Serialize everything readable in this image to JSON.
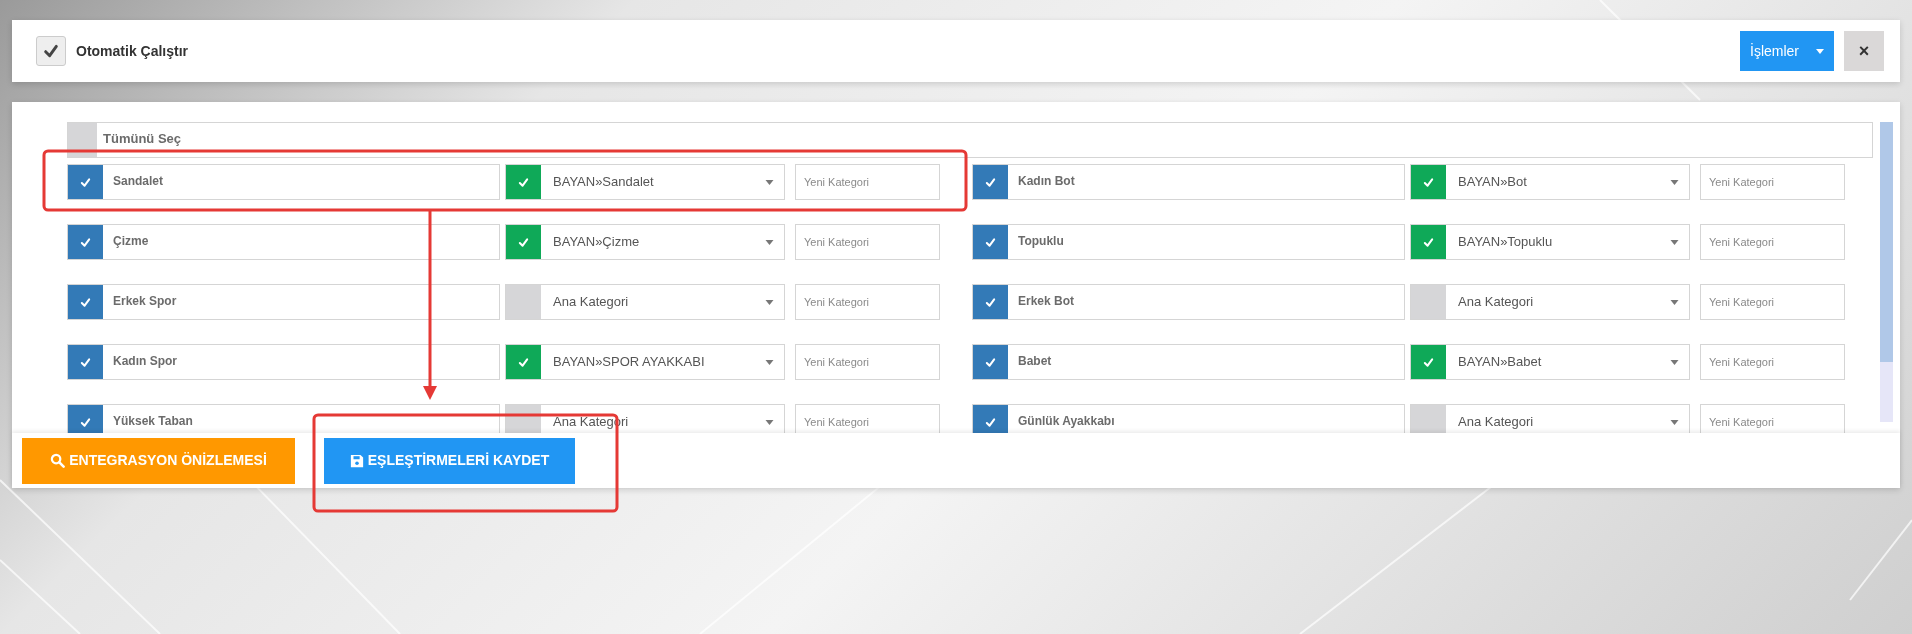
{
  "header": {
    "auto_run": {
      "label": "Otomatik Çalıştır",
      "checked": true
    },
    "actions_button": "İşlemler",
    "close_button": "×"
  },
  "select_all": {
    "label": "Tümünü Seç",
    "checked": false
  },
  "mappings": [
    {
      "checked": true,
      "name": "Sandalet",
      "category": "BAYAN»Sandalet",
      "matched": true,
      "new_category_placeholder": "Yeni Kategori"
    },
    {
      "checked": true,
      "name": "Kadın Bot",
      "category": "BAYAN»Bot",
      "matched": true,
      "new_category_placeholder": "Yeni Kategori"
    },
    {
      "checked": true,
      "name": "Çizme",
      "category": "BAYAN»Çizme",
      "matched": true,
      "new_category_placeholder": "Yeni Kategori"
    },
    {
      "checked": true,
      "name": "Topuklu",
      "category": "BAYAN»Topuklu",
      "matched": true,
      "new_category_placeholder": "Yeni Kategori"
    },
    {
      "checked": true,
      "name": "Erkek Spor",
      "category": "Ana Kategori",
      "matched": false,
      "new_category_placeholder": "Yeni Kategori"
    },
    {
      "checked": true,
      "name": "Erkek Bot",
      "category": "Ana Kategori",
      "matched": false,
      "new_category_placeholder": "Yeni Kategori"
    },
    {
      "checked": true,
      "name": "Kadın Spor",
      "category": "BAYAN»SPOR AYAKKABI",
      "matched": true,
      "new_category_placeholder": "Yeni Kategori"
    },
    {
      "checked": true,
      "name": "Babet",
      "category": "BAYAN»Babet",
      "matched": true,
      "new_category_placeholder": "Yeni Kategori"
    },
    {
      "checked": true,
      "name": "Yüksek Taban",
      "category": "Ana Kategori",
      "matched": false,
      "new_category_placeholder": "Yeni Kategori"
    },
    {
      "checked": true,
      "name": "Günlük Ayakkabı",
      "category": "Ana Kategori",
      "matched": false,
      "new_category_placeholder": "Yeni Kategori"
    }
  ],
  "footer": {
    "preview_button": "ENTEGRASYON ÖNİZLEMESİ",
    "save_button": "EŞLEŞTİRMELERİ KAYDET"
  }
}
